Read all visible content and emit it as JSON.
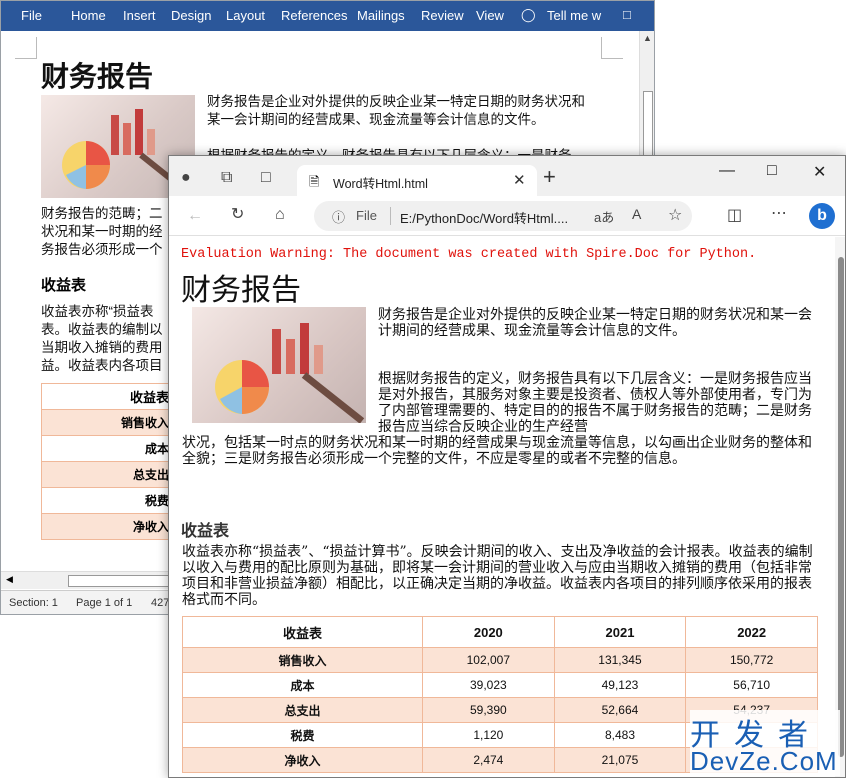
{
  "word": {
    "ribbon_tabs": [
      "File",
      "Home",
      "Insert",
      "Design",
      "Layout",
      "References",
      "Mailings",
      "Review",
      "View"
    ],
    "tell_me": "Tell me w",
    "title": "财务报告",
    "para1": "财务报告是企业对外提供的反映企业某一特定日期的财务状况和某一会计期间的经营成果、现金流量等会计信息的文件。",
    "para2": "根据财务报告的定义，财务报告具有以下几层含义：一是财务",
    "para3_lines": [
      "财务报告的范畴；二",
      "状况和某一时期的经",
      "务报告必须形成一个"
    ],
    "heading": "收益表",
    "para4_lines": [
      "收益表亦称“损益表",
      "表。收益表的编制以",
      "当期收入摊销的费用",
      "益。收益表内各项目"
    ],
    "table_rows": [
      "收益表",
      "销售收入",
      "成本",
      "总支出",
      "税费",
      "净收入"
    ],
    "status": {
      "section": "Section: 1",
      "page": "Page 1 of 1",
      "words": "427"
    }
  },
  "browser": {
    "tab_title": "Word转Html.html",
    "file_label": "File",
    "url": "E:/PythonDoc/Word转Html....",
    "read_aloud": "aあ",
    "text_size": "A",
    "warning": "Evaluation Warning: The document was created with Spire.Doc for Python.",
    "title": "财务报告",
    "para1": "财务报告是企业对外提供的反映企业某一特定日期的财务状况和某一会计期间的经营成果、现金流量等会计信息的文件。",
    "para2": "根据财务报告的定义，财务报告具有以下几层含义：一是财务报告应当是对外报告，其服务对象主要是投资者、债权人等外部使用者，专门为了内部管理需要的、特定目的的报告不属于财务报告的范畴；二是财务报告应当综合反映企业的生产经营",
    "para3": "状况，包括某一时点的财务状况和某一时期的经营成果与现金流量等信息，以勾画出企业财务的整体和全貌；三是财务报告必须形成一个完整的文件，不应是零星的或者不完整的信息。",
    "heading": "收益表",
    "para4": "收益表亦称“损益表”、“损益计算书”。反映会计期间的收入、支出及净收益的会计报表。收益表的编制以收入与费用的配比原则为基础，即将某一会计期间的营业收入与应由当期收入摊销的费用（包括非常项目和非营业损益净额）相配比，以正确决定当期的净收益。收益表内各项目的排列顺序依采用的报表格式而不同。",
    "table": {
      "header": [
        "收益表",
        "2020",
        "2021",
        "2022"
      ],
      "rows": [
        [
          "销售收入",
          "102,007",
          "131,345",
          "150,772"
        ],
        [
          "成本",
          "39,023",
          "49,123",
          "56,710"
        ],
        [
          "总支出",
          "59,390",
          "52,664",
          "54,237"
        ],
        [
          "税费",
          "1,120",
          "8,483",
          ""
        ],
        [
          "净收入",
          "2,474",
          "21,075",
          ""
        ]
      ]
    }
  },
  "watermark": {
    "cn": "开发者",
    "en": "DevZe.CoM"
  }
}
